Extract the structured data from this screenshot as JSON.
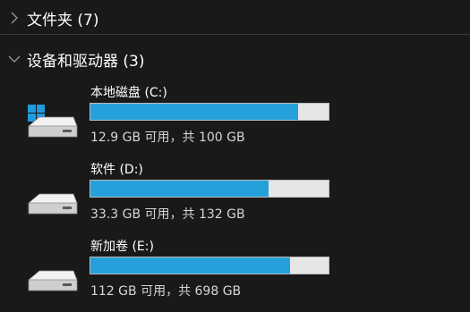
{
  "groups": {
    "folders": {
      "title": "文件夹 (7)",
      "expanded": false
    },
    "devices": {
      "title": "设备和驱动器 (3)",
      "expanded": true
    }
  },
  "drives": [
    {
      "name": "本地磁盘 (C:)",
      "info": "12.9 GB 可用，共 100 GB",
      "used_fraction": 0.871,
      "system_drive": true,
      "icon": "windows-hdd-icon"
    },
    {
      "name": "软件 (D:)",
      "info": "33.3 GB 可用，共 132 GB",
      "used_fraction": 0.748,
      "system_drive": false,
      "icon": "hdd-icon"
    },
    {
      "name": "新加卷 (E:)",
      "info": "112 GB 可用，共 698 GB",
      "used_fraction": 0.84,
      "system_drive": false,
      "icon": "hdd-icon"
    }
  ],
  "colors": {
    "background": "#191919",
    "bar_fill": "#26a0da",
    "bar_track": "#e6e6e6",
    "text_primary": "#ffffff",
    "text_secondary": "#d6d6d6"
  }
}
